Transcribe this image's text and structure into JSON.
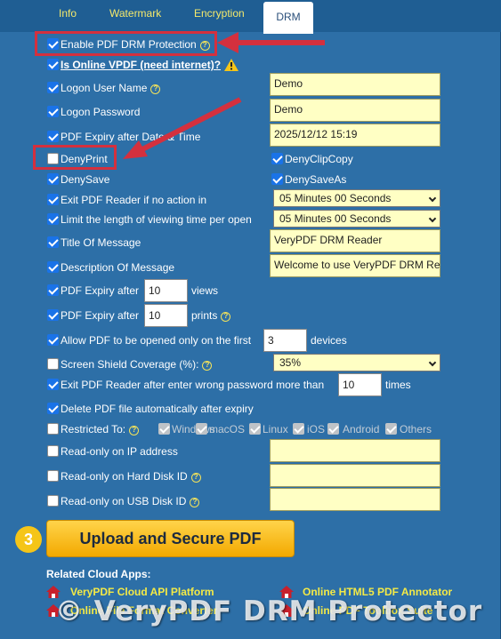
{
  "tabs": [
    "Info",
    "Watermark",
    "Encryption",
    "DRM"
  ],
  "options": {
    "enable_drm": "Enable PDF DRM Protection",
    "online_vpdf": "Is Online VPDF (need internet)?",
    "logon_user": "Logon User Name",
    "logon_password": "Logon Password",
    "pdf_expiry_date": "PDF Expiry after Date & Time",
    "deny_print": "DenyPrint",
    "deny_clip_copy": "DenyClipCopy",
    "deny_save": "DenySave",
    "deny_save_as": "DenySaveAs",
    "exit_no_action": "Exit PDF Reader if no action in",
    "limit_view_time": "Limit the length of viewing time per open",
    "title_message": "Title Of Message",
    "description_message": "Description Of Message",
    "expiry_after": "PDF Expiry after",
    "views": "views",
    "prints": "prints",
    "allow_first": "Allow PDF to be opened only on the first",
    "devices": "devices",
    "screen_shield": "Screen Shield Coverage (%):",
    "exit_wrong_pw": "Exit PDF Reader after enter wrong password more than",
    "times": "times",
    "delete_after_expiry": "Delete PDF file automatically after expiry",
    "restricted_to": "Restricted To:",
    "os": [
      "Windows",
      "macOS",
      "Linux",
      "iOS",
      "Android",
      "Others"
    ],
    "readonly_ip": "Read-only on IP address",
    "readonly_hdd": "Read-only on Hard Disk ID",
    "readonly_usb": "Read-only on USB Disk ID"
  },
  "values": {
    "user_name": "Demo",
    "password": "Demo",
    "expiry_date": "2025/12/12 15:19",
    "no_action": "05 Minutes 00 Seconds",
    "view_time": "05 Minutes 00 Seconds",
    "title": "VeryPDF DRM Reader",
    "description": "Welcome to use VeryPDF DRM Re",
    "views": "10",
    "prints": "10",
    "devices": "3",
    "shield": "35%",
    "wrong_pw": "10"
  },
  "upload": {
    "step": "3",
    "label": "Upload and Secure PDF"
  },
  "related": {
    "title": "Related Cloud Apps:",
    "links": [
      "VeryPDF Cloud API Platform",
      "Online HTML5 PDF Annotator",
      "Online File Format Converter",
      "Online PDF Toolbox Suite"
    ]
  },
  "watermark": "© VeryPDF DRM Protector",
  "colors": {
    "panel": "#2d6fa7",
    "link": "#f4ea46",
    "highlight": "#d4303e",
    "input": "#ffffc4"
  }
}
